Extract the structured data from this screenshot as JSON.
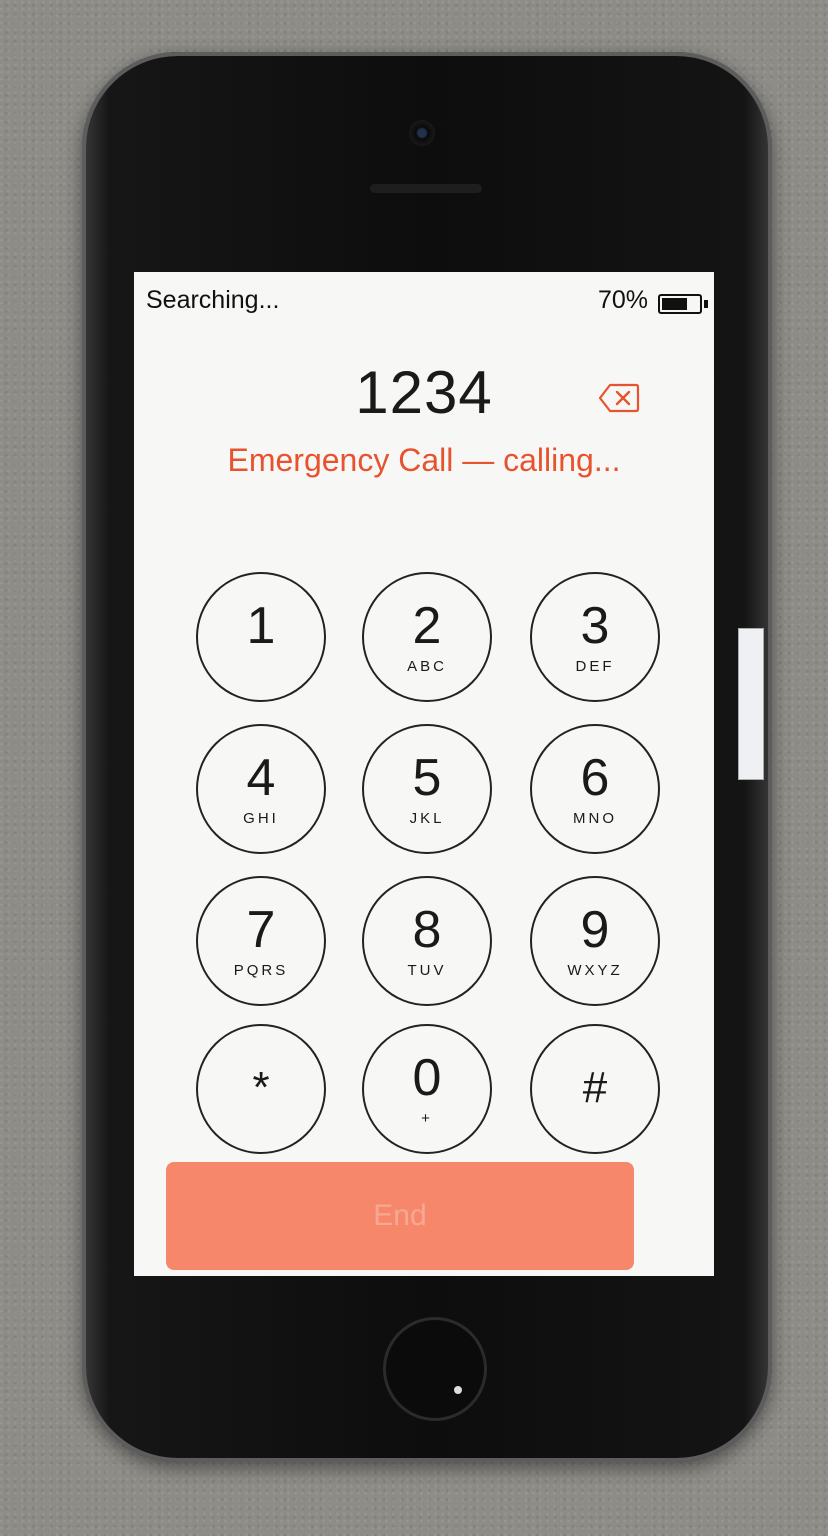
{
  "status_bar": {
    "carrier_text": "Searching...",
    "battery_percent": "70%",
    "battery_level": 0.7
  },
  "dialer": {
    "entered_number": "1234",
    "call_status": "Emergency Call — calling...",
    "keys": [
      {
        "digit": "1",
        "letters": ""
      },
      {
        "digit": "2",
        "letters": "ABC"
      },
      {
        "digit": "3",
        "letters": "DEF"
      },
      {
        "digit": "4",
        "letters": "GHI"
      },
      {
        "digit": "5",
        "letters": "JKL"
      },
      {
        "digit": "6",
        "letters": "MNO"
      },
      {
        "digit": "7",
        "letters": "PQRS"
      },
      {
        "digit": "8",
        "letters": "TUV"
      },
      {
        "digit": "9",
        "letters": "WXYZ"
      },
      {
        "digit": "*",
        "letters": ""
      },
      {
        "digit": "0",
        "letters": "+"
      },
      {
        "digit": "#",
        "letters": ""
      }
    ],
    "end_label": "End"
  },
  "colors": {
    "accent": "#e8532f",
    "end_button": "#f6876a"
  }
}
